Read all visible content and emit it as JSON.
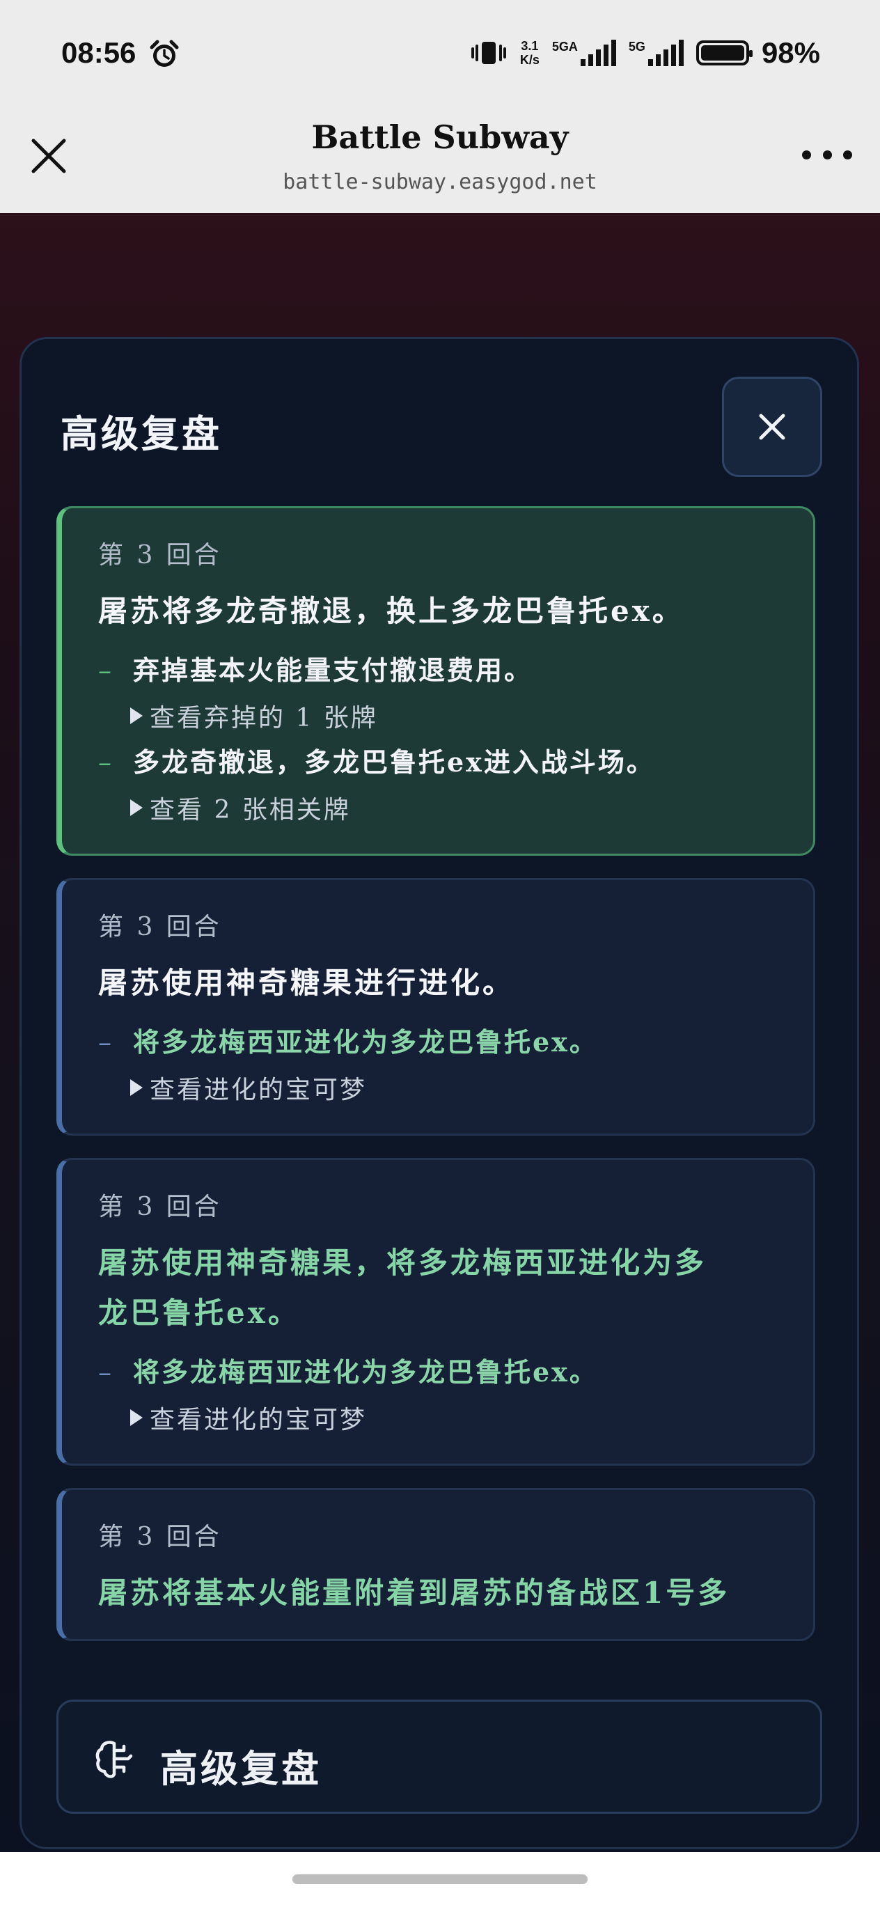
{
  "status_bar": {
    "time": "08:56",
    "alarm_icon": "alarm-clock-icon",
    "vibrate_icon": "vibrate-icon",
    "net_speed_value": "3.1",
    "net_speed_unit": "K/s",
    "network1_label": "5GA",
    "network2_label": "5G",
    "battery_percent": "98%",
    "battery_level": 0.98
  },
  "browser": {
    "title": "Battle Subway",
    "url": "battle-subway.easygod.net",
    "close_icon": "close-icon",
    "more_icon": "more-dots-icon"
  },
  "modal": {
    "title": "高级复盘",
    "close_icon": "close-icon",
    "entries": [
      {
        "round": "第 3 回合",
        "headline": "屠苏将多龙奇撤退，换上多龙巴鲁托ex。",
        "items": [
          {
            "text": "弃掉基本火能量支付撤退费用。",
            "toggle": "查看弃掉的 1 张牌"
          },
          {
            "text": "多龙奇撤退，多龙巴鲁托ex进入战斗场。",
            "toggle": "查看 2 张相关牌"
          }
        ]
      },
      {
        "round": "第 3 回合",
        "headline": "屠苏使用神奇糖果进行进化。",
        "items": [
          {
            "text": "将多龙梅西亚进化为多龙巴鲁托ex。",
            "toggle": "查看进化的宝可梦"
          }
        ]
      },
      {
        "round": "第 3 回合",
        "headline_line1": "屠苏使用神奇糖果，将多龙梅西亚进化为多",
        "headline_line2": "龙巴鲁托ex。",
        "items": [
          {
            "text": "将多龙梅西亚进化为多龙巴鲁托ex。",
            "toggle": "查看进化的宝可梦"
          }
        ]
      },
      {
        "round": "第 3 回合",
        "headline": "屠苏将基本火能量附着到屠苏的备战区1号多"
      }
    ],
    "footer": {
      "icon": "brain-icon",
      "label": "高级复盘"
    }
  }
}
